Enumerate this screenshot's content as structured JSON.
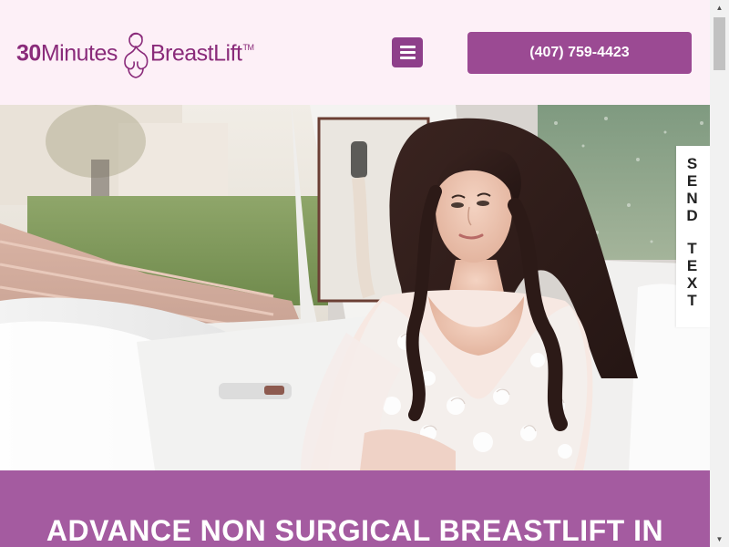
{
  "header": {
    "logo": {
      "number": "30",
      "word1": "Minutes",
      "word2": "BreastLift",
      "trademark": "TM"
    },
    "menu_icon": "hamburger-menu-icon",
    "phone_label": "(407) 759-4423"
  },
  "hero": {
    "image": "bride-in-white-car-photo"
  },
  "send_text": {
    "word1": [
      "S",
      "E",
      "N",
      "D"
    ],
    "word2": [
      "T",
      "E",
      "X",
      "T"
    ]
  },
  "banner": {
    "title": "ADVANCE NON SURGICAL BREASTLIFT IN"
  },
  "colors": {
    "brand_purple": "#8a2b7a",
    "button_purple": "#9b4a93",
    "banner_purple": "#a45ba0",
    "header_bg": "#fdf0f7"
  },
  "scrollbar": {
    "up_icon": "arrow-up-icon",
    "down_icon": "arrow-down-icon"
  }
}
